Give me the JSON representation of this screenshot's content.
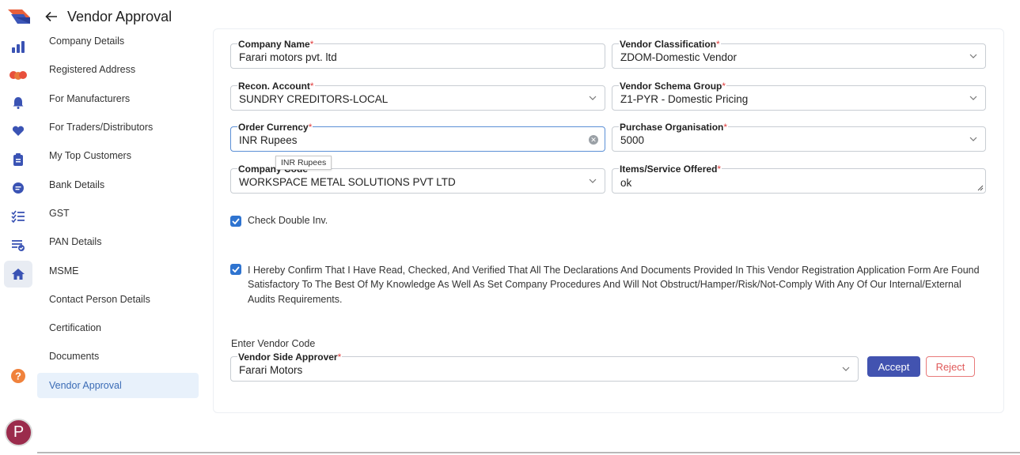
{
  "header": {
    "title": "Vendor Approval"
  },
  "rail": {
    "icons": [
      "app-logo-icon",
      "analytics-icon",
      "partners-icon",
      "bell-icon",
      "heart-icon",
      "clipboard-icon",
      "message-icon",
      "checklist-icon",
      "approval-list-icon",
      "home-icon",
      "help-icon"
    ],
    "avatar_letter": "P"
  },
  "sections": [
    "Company Details",
    "Registered Address",
    "For Manufacturers",
    "For Traders/Distributors",
    "My Top Customers",
    "Bank Details",
    "GST",
    "PAN Details",
    "MSME",
    "Contact Person Details",
    "Certification",
    "Documents",
    "Vendor Approval"
  ],
  "form": {
    "company_name": {
      "label": "Company Name",
      "value": "Farari motors pvt. ltd"
    },
    "vendor_classification": {
      "label": "Vendor Classification",
      "value": "ZDOM-Domestic Vendor"
    },
    "recon_account": {
      "label": "Recon. Account",
      "value": "SUNDRY CREDITORS-LOCAL"
    },
    "vendor_schema_group": {
      "label": "Vendor Schema Group",
      "value": "Z1-PYR - Domestic Pricing"
    },
    "order_currency": {
      "label": "Order Currency",
      "value": "INR Rupees",
      "tooltip": "INR Rupees"
    },
    "purchase_organisation": {
      "label": "Purchase Organisation",
      "value": "5000"
    },
    "company_code": {
      "label": "Company Code",
      "value": "WORKSPACE METAL SOLUTIONS PVT LTD"
    },
    "items_service_offered": {
      "label": "Items/Service Offered",
      "value": "ok"
    },
    "check_double_inv": {
      "label": "Check Double Inv.",
      "checked": true
    },
    "declaration": {
      "text": "I Hereby Confirm That I Have Read, Checked, And Verified That All The Declarations And Documents Provided In This Vendor Registration Application Form Are Found Satisfactory To The Best Of My Knowledge As Well As Set Company Procedures And Will Not Obstruct/Hamper/Risk/Not-Comply With Any Of Our Internal/External Audits Requirements.",
      "checked": true
    },
    "enter_vendor_code": "Enter Vendor Code",
    "vendor_side_approver": {
      "label": "Vendor Side Approver",
      "value": "Farari Motors"
    },
    "required_mark": "*"
  },
  "buttons": {
    "accept": "Accept",
    "reject": "Reject"
  },
  "colors": {
    "accent": "#4253b0",
    "checkbox": "#2f74d0",
    "required": "#e03c3c",
    "active_nav_bg": "#e8f1fb",
    "reject": "#e05a5a"
  }
}
